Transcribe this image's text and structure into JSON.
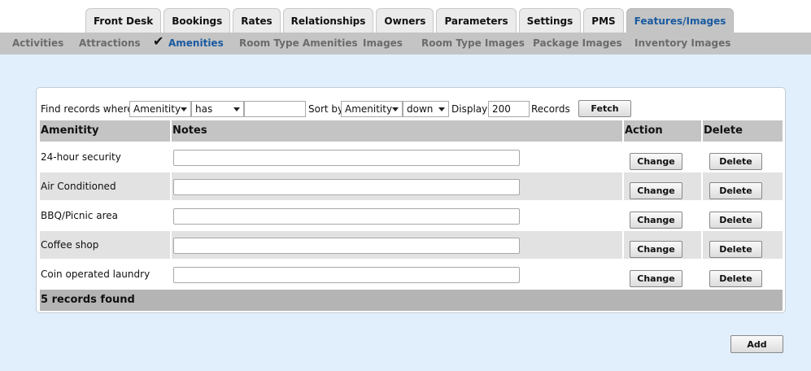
{
  "tabs": [
    {
      "label": "Front Desk"
    },
    {
      "label": "Bookings"
    },
    {
      "label": "Rates"
    },
    {
      "label": "Relationships"
    },
    {
      "label": "Owners"
    },
    {
      "label": "Parameters"
    },
    {
      "label": "Settings"
    },
    {
      "label": "PMS"
    },
    {
      "label": "Features/Images",
      "active": true
    }
  ],
  "subnav": [
    {
      "label": "Activities"
    },
    {
      "label": "Attractions"
    },
    {
      "label": "Amenities",
      "active": true
    },
    {
      "label": "Room Type Amenities"
    },
    {
      "label": "Images"
    },
    {
      "label": "Room Type Images"
    },
    {
      "label": "Package Images"
    },
    {
      "label": "Inventory Images"
    }
  ],
  "filter": {
    "find_label": "Find records where",
    "field_value": "Amenitity",
    "operator_value": "has",
    "search_value": "",
    "sort_label": "Sort by",
    "sort_field_value": "Amenitity",
    "sort_dir_value": "down",
    "display_label": "Display",
    "display_value": "200",
    "records_label": "Records",
    "fetch_label": "Fetch"
  },
  "table": {
    "headers": [
      "Amenitity",
      "Notes",
      "Action",
      "Delete"
    ],
    "rows": [
      {
        "name": "24-hour security",
        "notes": "",
        "change": "Change",
        "delete": "Delete"
      },
      {
        "name": "Air Conditioned",
        "notes": "",
        "change": "Change",
        "delete": "Delete"
      },
      {
        "name": "BBQ/Picnic area",
        "notes": "",
        "change": "Change",
        "delete": "Delete"
      },
      {
        "name": "Coffee shop",
        "notes": "",
        "change": "Change",
        "delete": "Delete"
      },
      {
        "name": "Coin operated laundry",
        "notes": "",
        "change": "Change",
        "delete": "Delete"
      }
    ],
    "footer": "5 records found"
  },
  "add_label": "Add",
  "icons": {
    "active_subnav": "check-icon"
  },
  "colors": {
    "accent": "#1a5aa0",
    "content_bg": "#e1effd",
    "header_bg": "#c4c4c4"
  }
}
